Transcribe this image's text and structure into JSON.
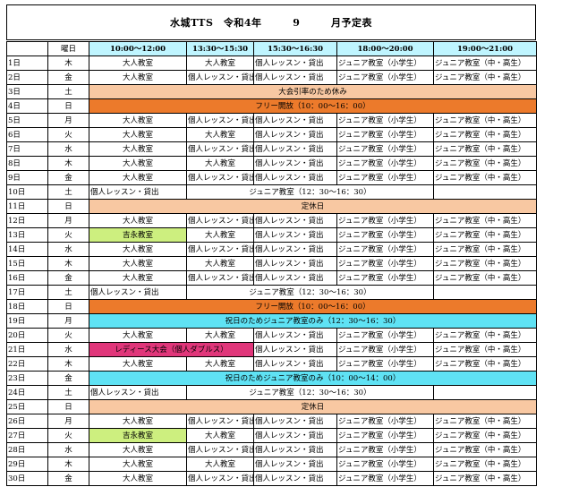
{
  "header": {
    "title_left": "水城TTS　令和4年",
    "month": "9",
    "title_right": "月予定表"
  },
  "columns": {
    "date": "",
    "weekday": "曜日",
    "slots": [
      "10:00〜12:00",
      "13:30〜15:30",
      "15:30〜16:30",
      "18:00〜20:00",
      "19:00〜21:00"
    ]
  },
  "colors": {
    "header_cyan": "#bff5ff",
    "peach": "#f8c8a2",
    "orange": "#ec7a2b",
    "cyan": "#5fe2f4",
    "lime": "#cdef7f",
    "magenta": "#e0367a"
  },
  "rows": [
    {
      "date": "1日",
      "dow": "木",
      "cells": [
        "大人教室",
        "大人教室",
        "個人レッスン・貸出",
        "ジュニア教室（小学生）",
        "ジュニア教室（中・高生）"
      ]
    },
    {
      "date": "2日",
      "dow": "金",
      "cells": [
        "大人教室",
        "個人レッスン・貸出",
        "個人レッスン・貸出",
        "ジュニア教室（小学生）",
        "ジュニア教室（中・高生）"
      ]
    },
    {
      "date": "3日",
      "dow": "土",
      "span": "大会引率のため休み"
    },
    {
      "date": "4日",
      "dow": "日",
      "span": "フリー開放（10：00〜16：00）"
    },
    {
      "date": "5日",
      "dow": "月",
      "cells": [
        "大人教室",
        "個人レッスン・貸出",
        "個人レッスン・貸出",
        "ジュニア教室（小学生）",
        "ジュニア教室（中・高生）"
      ]
    },
    {
      "date": "6日",
      "dow": "火",
      "cells": [
        "大人教室",
        "大人教室",
        "個人レッスン・貸出",
        "ジュニア教室（小学生）",
        "ジュニア教室（中・高生）"
      ]
    },
    {
      "date": "7日",
      "dow": "水",
      "cells": [
        "大人教室",
        "個人レッスン・貸出",
        "個人レッスン・貸出",
        "ジュニア教室（小学生）",
        "ジュニア教室（中・高生）"
      ]
    },
    {
      "date": "8日",
      "dow": "木",
      "cells": [
        "大人教室",
        "大人教室",
        "個人レッスン・貸出",
        "ジュニア教室（小学生）",
        "ジュニア教室（中・高生）"
      ]
    },
    {
      "date": "9日",
      "dow": "金",
      "cells": [
        "大人教室",
        "個人レッスン・貸出",
        "個人レッスン・貸出",
        "ジュニア教室（小学生）",
        "ジュニア教室（中・高生）"
      ]
    },
    {
      "date": "10日",
      "dow": "土",
      "sat": [
        "個人レッスン・貸出",
        "ジュニア教室（12：30〜16：30）"
      ]
    },
    {
      "date": "11日",
      "dow": "日",
      "span": "定休日"
    },
    {
      "date": "12日",
      "dow": "月",
      "cells": [
        "大人教室",
        "個人レッスン・貸出",
        "個人レッスン・貸出",
        "ジュニア教室（小学生）",
        "ジュニア教室（中・高生）"
      ]
    },
    {
      "date": "13日",
      "dow": "火",
      "cells": [
        "吉永教室",
        "大人教室",
        "個人レッスン・貸出",
        "ジュニア教室（小学生）",
        "ジュニア教室（中・高生）"
      ],
      "hl": "lime"
    },
    {
      "date": "14日",
      "dow": "水",
      "cells": [
        "大人教室",
        "個人レッスン・貸出",
        "個人レッスン・貸出",
        "ジュニア教室（小学生）",
        "ジュニア教室（中・高生）"
      ]
    },
    {
      "date": "15日",
      "dow": "木",
      "cells": [
        "大人教室",
        "大人教室",
        "個人レッスン・貸出",
        "ジュニア教室（小学生）",
        "ジュニア教室（中・高生）"
      ]
    },
    {
      "date": "16日",
      "dow": "金",
      "cells": [
        "大人教室",
        "個人レッスン・貸出",
        "個人レッスン・貸出",
        "ジュニア教室（小学生）",
        "ジュニア教室（中・高生）"
      ]
    },
    {
      "date": "17日",
      "dow": "土",
      "sat": [
        "個人レッスン・貸出",
        "ジュニア教室（12：30〜16：30）"
      ]
    },
    {
      "date": "18日",
      "dow": "日",
      "span": "フリー開放（10：00〜16：00）"
    },
    {
      "date": "19日",
      "dow": "月",
      "span": "祝日のためジュニア教室のみ（12：30〜16：30）"
    },
    {
      "date": "20日",
      "dow": "火",
      "cells": [
        "大人教室",
        "大人教室",
        "個人レッスン・貸出",
        "ジュニア教室（小学生）",
        "ジュニア教室（中・高生）"
      ]
    },
    {
      "date": "21日",
      "dow": "水",
      "event": "レディース大会（個人ダブルス）",
      "cells3": [
        "個人レッスン・貸出",
        "ジュニア教室（小学生）",
        "ジュニア教室（中・高生）"
      ]
    },
    {
      "date": "22日",
      "dow": "木",
      "cells": [
        "大人教室",
        "大人教室",
        "個人レッスン・貸出",
        "ジュニア教室（小学生）",
        "ジュニア教室（中・高生）"
      ]
    },
    {
      "date": "23日",
      "dow": "金",
      "span": "祝日のためジュニア教室のみ（10：00〜14：00）"
    },
    {
      "date": "24日",
      "dow": "土",
      "sat": [
        "個人レッスン・貸出",
        "ジュニア教室（12：30〜16：30）"
      ]
    },
    {
      "date": "25日",
      "dow": "日",
      "span": "定休日"
    },
    {
      "date": "26日",
      "dow": "月",
      "cells": [
        "大人教室",
        "個人レッスン・貸出",
        "個人レッスン・貸出",
        "ジュニア教室（小学生）",
        "ジュニア教室（中・高生）"
      ]
    },
    {
      "date": "27日",
      "dow": "火",
      "cells": [
        "吉永教室",
        "大人教室",
        "個人レッスン・貸出",
        "ジュニア教室（小学生）",
        "ジュニア教室（中・高生）"
      ],
      "hl": "lime"
    },
    {
      "date": "28日",
      "dow": "水",
      "cells": [
        "大人教室",
        "個人レッスン・貸出",
        "個人レッスン・貸出",
        "ジュニア教室（小学生）",
        "ジュニア教室（中・高生）"
      ]
    },
    {
      "date": "29日",
      "dow": "木",
      "cells": [
        "大人教室",
        "大人教室",
        "個人レッスン・貸出",
        "ジュニア教室（小学生）",
        "ジュニア教室（中・高生）"
      ]
    },
    {
      "date": "30日",
      "dow": "金",
      "cells": [
        "大人教室",
        "個人レッスン・貸出",
        "個人レッスン・貸出",
        "ジュニア教室（小学生）",
        "ジュニア教室（中・高生）"
      ]
    }
  ]
}
